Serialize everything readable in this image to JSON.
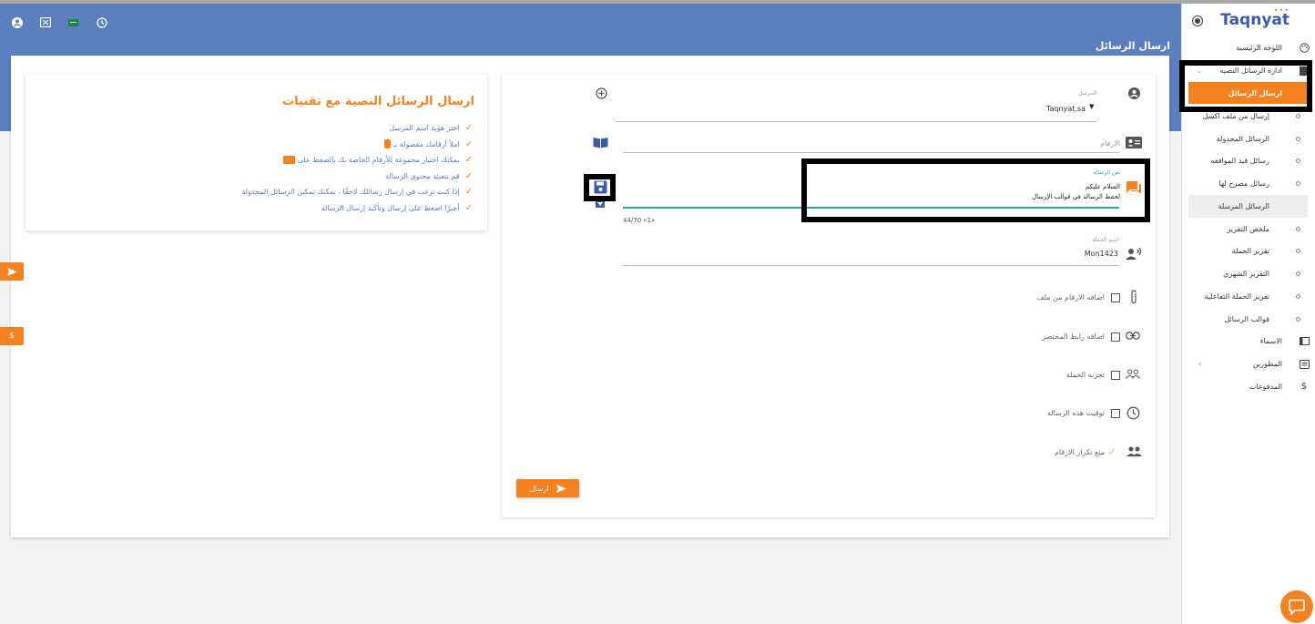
{
  "page": {
    "title": "ارسال الرسائل"
  },
  "info": {
    "title": "ارسال الرسائل النصية مع تقنيات",
    "steps": [
      "اختر هوية اسم المرسل",
      "املأ أرقامك مفصولة بـ",
      "يمكنك اختيار مجموعة للأرقام الخاصة بك بالضغط على",
      "قم بتعبئة محتوى الرسالة",
      "إذا كنت ترغب في إرسال رسائلك لاحقًا ، يمكنك تمكين الرسائل المجدولة",
      "أخيرًا اضغط على إرسال وتأكيد إرسال الرسالة"
    ]
  },
  "form": {
    "sender_label": "المرسل",
    "sender_value": "Taqnyat.sa",
    "numbers_placeholder": "الارقام",
    "message_label": "نص الرسالة",
    "message_line1": "السلام عليكم",
    "message_line2": "لحفظ الرسالة في قوالب الإرسال",
    "char_counter": "44/70 ‎«1»",
    "campaign_label": "اسم الحملة",
    "campaign_value": "Mon1423",
    "options": [
      {
        "label": "اضافه الارقام من ملف",
        "icon": "paperclip-icon"
      },
      {
        "label": "اضافه رابط المختصر",
        "icon": "link-icon"
      },
      {
        "label": "تجربه الحملة",
        "icon": "group-icon"
      },
      {
        "label": "توقيت هذه الرساله",
        "icon": "clock-icon"
      },
      {
        "label": "منع تكرار الارقام",
        "icon": "people-icon"
      }
    ],
    "send_label": "ارسال"
  },
  "sidetabs": {
    "dollar": "$"
  },
  "sidebar": {
    "logo": "Taqnyat",
    "items": [
      {
        "label": "اللوحة الرئيسية"
      },
      {
        "label": "ادارة الرسائل النصيه"
      },
      {
        "label": "ارسال الرسائل"
      },
      {
        "label": "إرسال من ملف اكسل"
      },
      {
        "label": "الرسائل المجدولة"
      },
      {
        "label": "رسائل قيد الموافقه"
      },
      {
        "label": "رسائل مصرح لها"
      },
      {
        "label": "الرسائل المرسلة"
      },
      {
        "label": "ملخص التقرير"
      },
      {
        "label": "تقرير الحملة"
      },
      {
        "label": "التقرير الشهري"
      },
      {
        "label": "تقرير الحملة التفاعلية"
      },
      {
        "label": "قوالب الرسائل"
      },
      {
        "label": "الاسماء"
      },
      {
        "label": "المطورين"
      },
      {
        "label": "المدفوعات"
      }
    ]
  },
  "colors": {
    "header": "#5b7fbf",
    "accent": "#f58220",
    "focus": "#20b2aa"
  }
}
